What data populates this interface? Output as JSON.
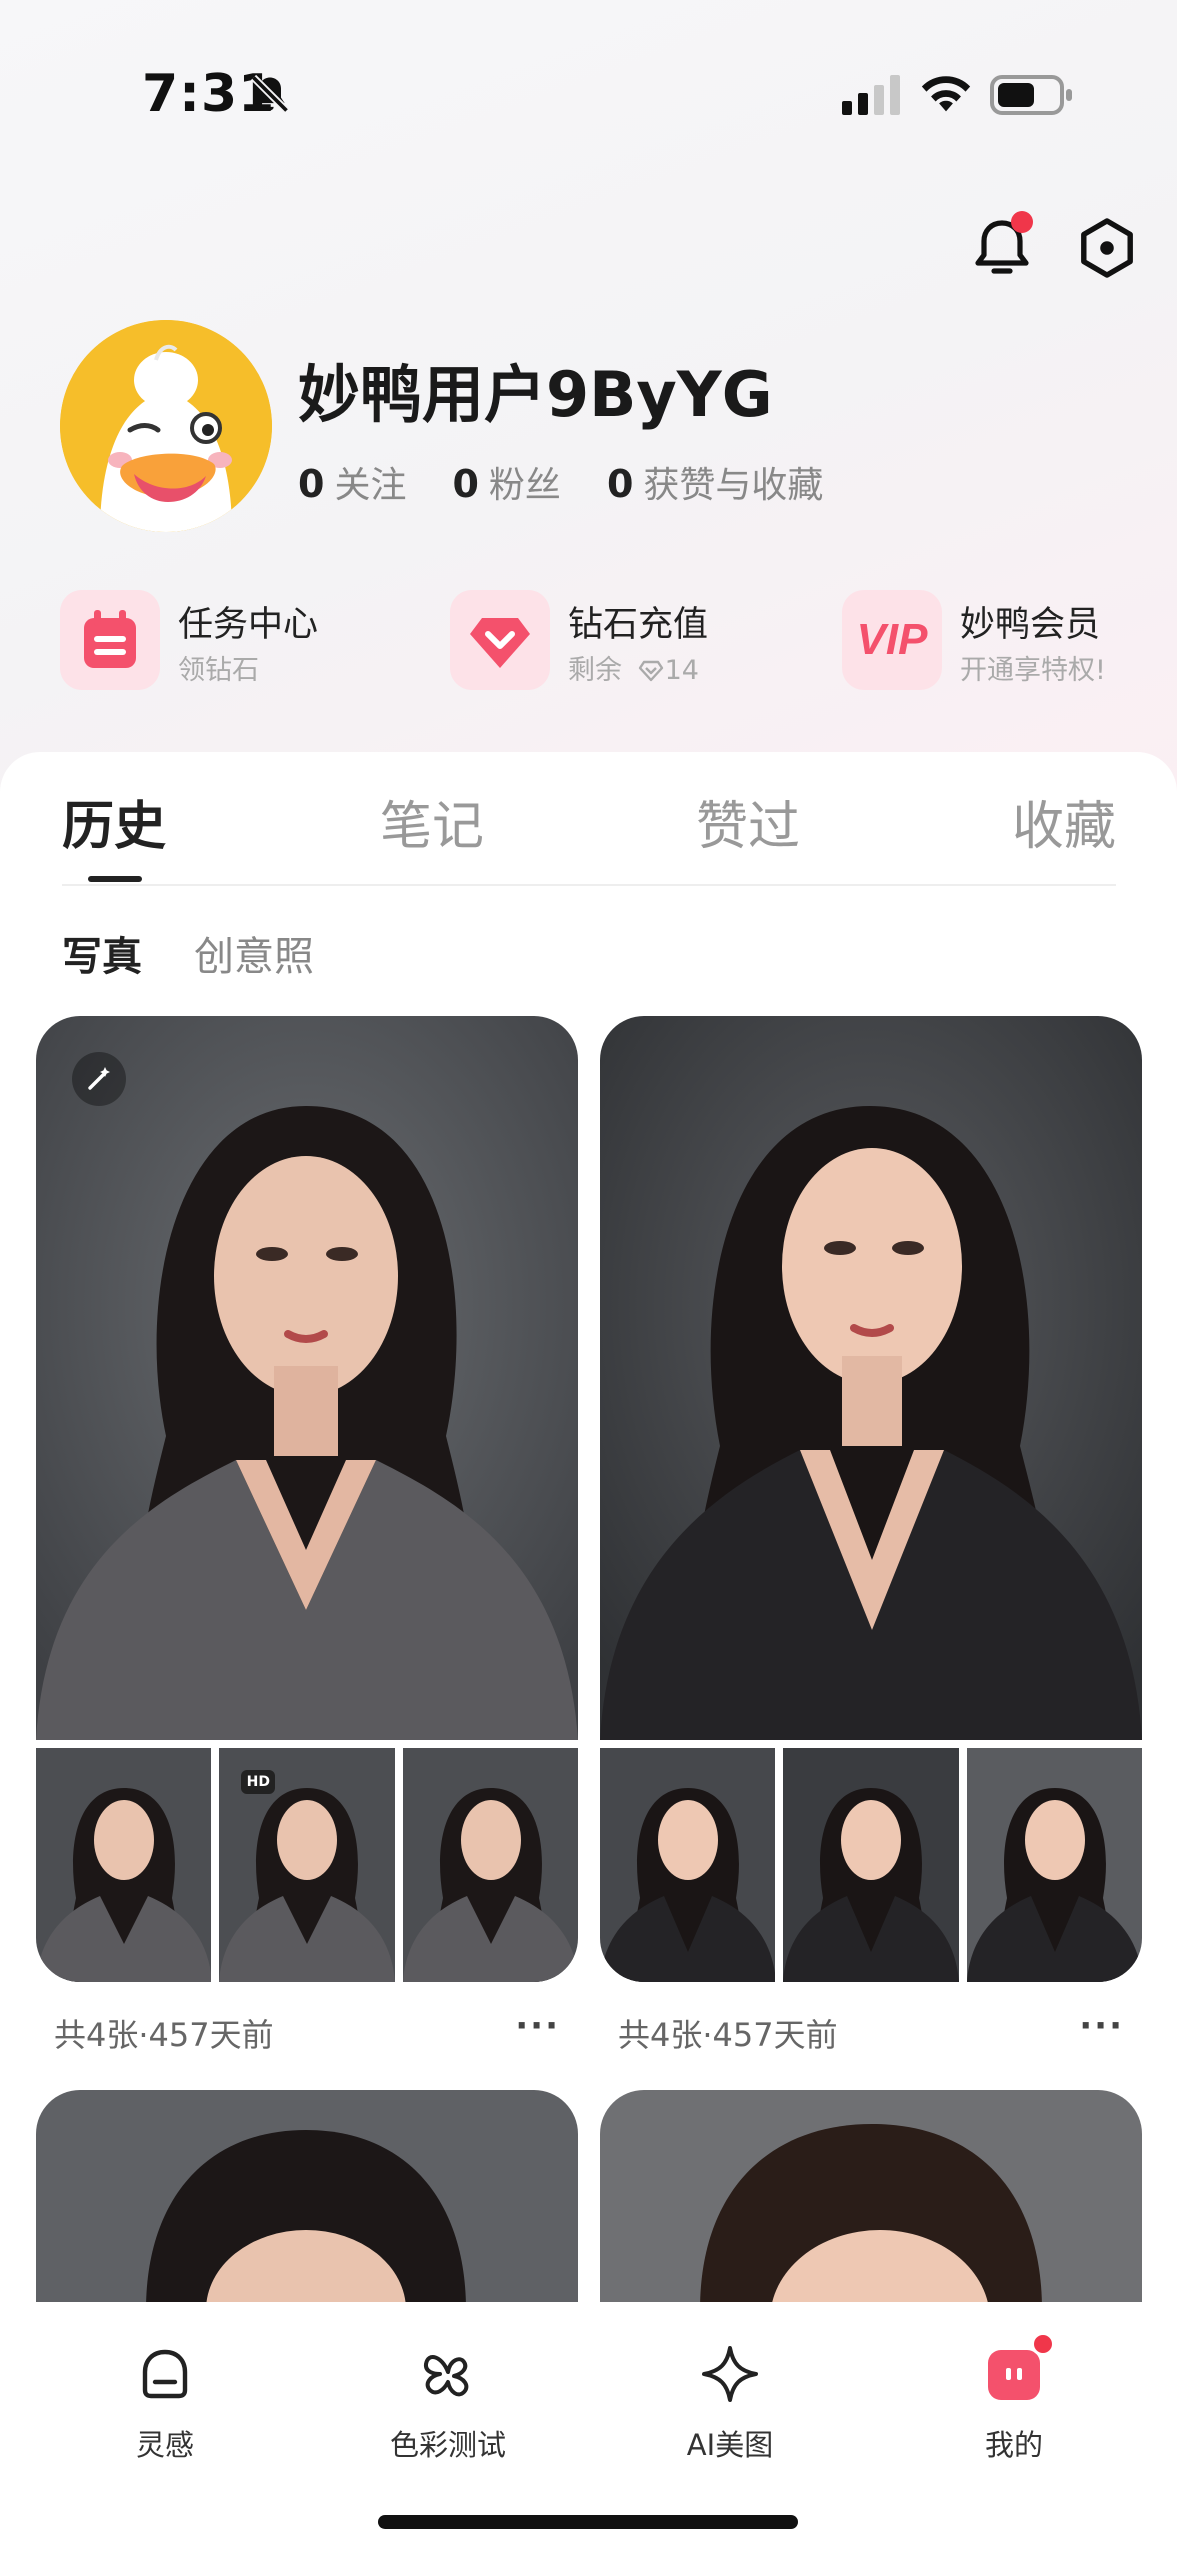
{
  "status_bar": {
    "time": "7:31"
  },
  "profile": {
    "username": "妙鸭用户9ByYG",
    "stats": [
      {
        "count": "0",
        "label": "关注"
      },
      {
        "count": "0",
        "label": "粉丝"
      },
      {
        "count": "0",
        "label": "获赞与收藏"
      }
    ]
  },
  "shortcuts": [
    {
      "title": "任务中心",
      "subtitle": "领钻石"
    },
    {
      "title": "钻石充值",
      "subtitle_prefix": "剩余",
      "subtitle_value": "14"
    },
    {
      "title": "妙鸭会员",
      "subtitle": "开通享特权!",
      "icon_text": "VIP"
    }
  ],
  "tabs": [
    "历史",
    "笔记",
    "赞过",
    "收藏"
  ],
  "active_tab": "历史",
  "subtabs": [
    "写真",
    "创意照"
  ],
  "active_subtab": "写真",
  "albums": [
    {
      "meta": "共4张·457天前",
      "more": "···",
      "hd_label": "HD"
    },
    {
      "meta": "共4张·457天前",
      "more": "···"
    }
  ],
  "bottom_nav": [
    {
      "label": "灵感",
      "icon": "inspiration-icon"
    },
    {
      "label": "色彩测试",
      "icon": "color-test-icon"
    },
    {
      "label": "AI美图",
      "icon": "sparkle-icon"
    },
    {
      "label": "我的",
      "icon": "profile-icon",
      "badge": true
    }
  ],
  "colors": {
    "accent": "#f0364a",
    "pink_icon": "#f4516c",
    "avatar_yellow": "#f6be2a"
  }
}
